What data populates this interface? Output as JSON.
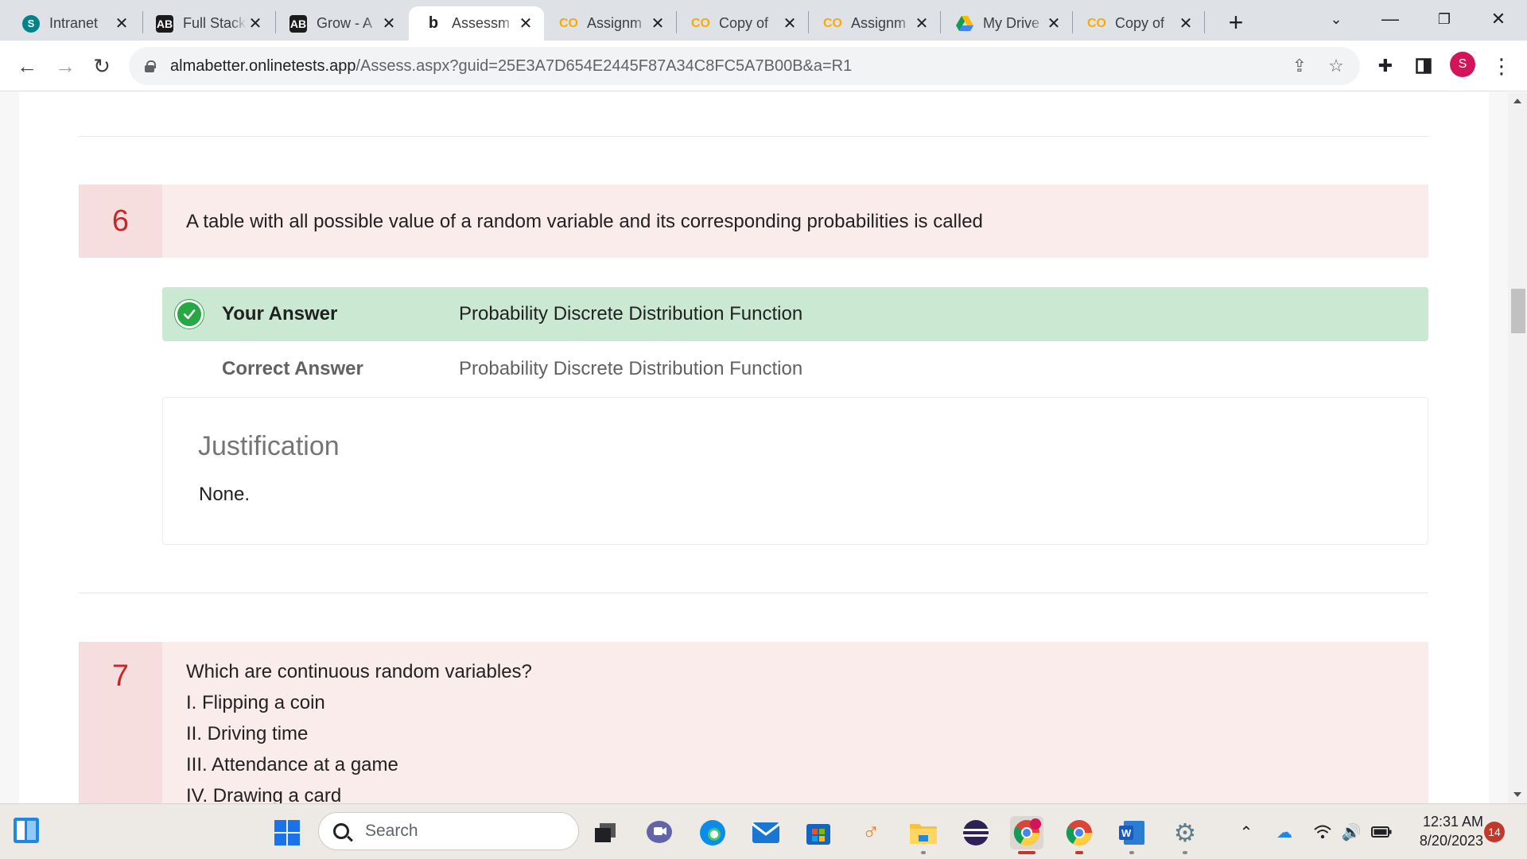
{
  "tabs": [
    {
      "title": "Intranet",
      "favicon": "sp-icon",
      "active": false
    },
    {
      "title": "Full Stack",
      "favicon": "ab-icon",
      "active": false
    },
    {
      "title": "Grow - A",
      "favicon": "ab-icon",
      "active": false
    },
    {
      "title": "Assessm",
      "favicon": "bing-icon",
      "active": true
    },
    {
      "title": "Assignm",
      "favicon": "colab-icon",
      "active": false
    },
    {
      "title": "Copy of",
      "favicon": "colab-icon",
      "active": false
    },
    {
      "title": "Assignm",
      "favicon": "colab-icon",
      "active": false
    },
    {
      "title": "My Drive",
      "favicon": "drive-icon",
      "active": false
    },
    {
      "title": "Copy of",
      "favicon": "colab-icon",
      "active": false
    }
  ],
  "favicon_text": {
    "sp": "S",
    "ab": "AB",
    "bing": "b",
    "colab": "CO"
  },
  "address": {
    "host": "almabetter.onlinetests.app",
    "path": "/Assess.aspx?guid=25E3A7D654E2445F87A34C8FC5A7B00B&a=R1"
  },
  "profile_initial": "S",
  "questions": [
    {
      "number": "6",
      "lines": [
        "A table with all possible value of a random variable and its corresponding probabilities is called"
      ],
      "your_answer_label": "Your Answer",
      "your_answer": "Probability Discrete Distribution Function",
      "correct_answer_label": "Correct Answer",
      "correct_answer": "Probability Discrete Distribution Function",
      "justification_title": "Justification",
      "justification": "None."
    },
    {
      "number": "7",
      "lines": [
        "Which are continuous random variables?",
        "I. Flipping a coin",
        "II. Driving time",
        "III. Attendance at a game",
        "IV. Drawing a card"
      ]
    }
  ],
  "taskbar": {
    "search_placeholder": "Search",
    "time": "12:31 AM",
    "date": "8/20/2023",
    "notification_count": "14"
  },
  "colors": {
    "question_bg": "#fbecec",
    "number_bg": "#f6dede",
    "number_text": "#c62828",
    "your_answer_bg": "#cbe9d2",
    "check": "#28a745"
  }
}
